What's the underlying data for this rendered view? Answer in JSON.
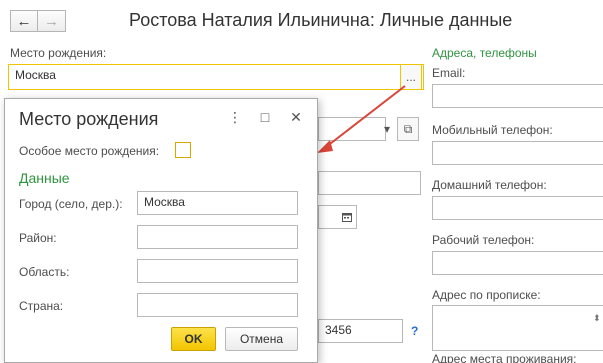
{
  "header": {
    "back_icon": "←",
    "forward_icon": "→",
    "title": "Ростова Наталия Ильинична: Личные данные"
  },
  "form": {
    "birthplace_label": "Место рождения:",
    "birthplace_value": "Москва",
    "select_button": "...",
    "partial_phone_value": "3456",
    "help": "?"
  },
  "contacts": {
    "section_title": "Адреса, телефоны",
    "email_label": "Email:",
    "mobile_label": "Мобильный телефон:",
    "home_label": "Домашний телефон:",
    "work_label": "Рабочий телефон:",
    "registration_label": "Адрес по прописке:",
    "residence_label": "Адрес места проживания:"
  },
  "dialog": {
    "title": "Место рождения",
    "menu_icon": "⋮",
    "maximize_icon": "□",
    "close_icon": "✕",
    "special_label": "Особое место рождения:",
    "section_title": "Данные",
    "city_label": "Город (село, дер.):",
    "city_value": "Москва",
    "district_label": "Район:",
    "district_value": "",
    "region_label": "Область:",
    "region_value": "",
    "country_label": "Страна:",
    "country_value": "",
    "ok_label": "OK",
    "cancel_label": "Отмена"
  },
  "colors": {
    "accent_green": "#2f9440",
    "focus_yellow": "#f0c400",
    "ok_yellow": "#f3c500",
    "arrow_red": "#d9453a"
  }
}
